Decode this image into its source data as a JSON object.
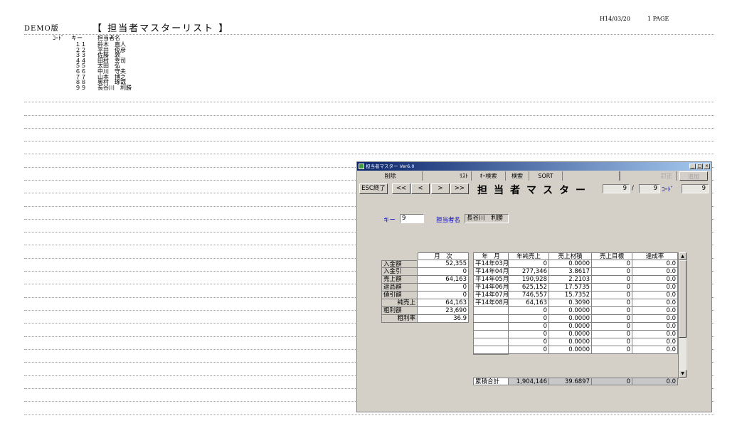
{
  "report": {
    "demo_label": "DEMO版",
    "title": "【 担当者マスターリスト 】",
    "date": "H14/03/20",
    "page": "1 PAGE",
    "col_code": "ｺｰﾄﾞ",
    "col_key": "キー",
    "col_name": "担当者名",
    "rows": [
      {
        "key": "１１",
        "name": "鈴木　直人"
      },
      {
        "key": "２２",
        "name": "平井　俊彦"
      },
      {
        "key": "３３",
        "name": "佐藤　敦"
      },
      {
        "key": "４４",
        "name": "田村　幸司"
      },
      {
        "key": "５５",
        "name": "太田　弘"
      },
      {
        "key": "６６",
        "name": "中川　守夫"
      },
      {
        "key": "７７",
        "name": "山本　博之"
      },
      {
        "key": "８８",
        "name": "奥村　琢哉"
      },
      {
        "key": "９９",
        "name": "長谷川　利勝"
      }
    ]
  },
  "window": {
    "title": "担当者マスター Ver6.0",
    "min_glyph": "_",
    "max_glyph": "□",
    "close_glyph": "×",
    "toolbar": {
      "delete": "削除",
      "list": "ﾘｽﾄ",
      "key_search": "ｷｰ検索",
      "search": "検索",
      "sort": "SORT",
      "correct": "訂正",
      "add": "追加"
    },
    "esc_button": "ESC終了",
    "nav": {
      "first": "<<",
      "prev": "<",
      "next": ">",
      "last": ">>"
    },
    "screen_title": "担当者マスター",
    "record_current": "9",
    "record_sep": "/",
    "record_total": "9",
    "code_label": "ｺｰﾄﾞ",
    "code_value": "9",
    "key_label": "キー",
    "key_value": "9",
    "name_label": "担当者名",
    "name_value": "長谷川　利勝",
    "monthly": {
      "header": "月　次",
      "rows": [
        {
          "label": "入金額",
          "value": "52,355"
        },
        {
          "label": "入金引",
          "value": "0"
        },
        {
          "label": "売上額",
          "value": "64,163"
        },
        {
          "label": "返品額",
          "value": "0"
        },
        {
          "label": "値引額",
          "value": "0"
        },
        {
          "label": "純売上",
          "value": "64,163"
        },
        {
          "label": "粗利額",
          "value": "23,690"
        },
        {
          "label": "粗利率",
          "value": "36.9"
        }
      ]
    },
    "yearly": {
      "headers": [
        "年　月",
        "年純売上",
        "売上材積",
        "売上目標",
        "達成率"
      ],
      "rows": [
        {
          "ym": "平14年03月",
          "sales": "0",
          "vol": "0.0000",
          "target": "0",
          "rate": "0.0"
        },
        {
          "ym": "平14年04月",
          "sales": "277,346",
          "vol": "3.8617",
          "target": "0",
          "rate": "0.0"
        },
        {
          "ym": "平14年05月",
          "sales": "190,928",
          "vol": "2.2103",
          "target": "0",
          "rate": "0.0"
        },
        {
          "ym": "平14年06月",
          "sales": "625,152",
          "vol": "17.5735",
          "target": "0",
          "rate": "0.0"
        },
        {
          "ym": "平14年07月",
          "sales": "746,557",
          "vol": "15.7352",
          "target": "0",
          "rate": "0.0"
        },
        {
          "ym": "平14年08月",
          "sales": "64,163",
          "vol": "0.3090",
          "target": "0",
          "rate": "0.0"
        },
        {
          "ym": "",
          "sales": "0",
          "vol": "0.0000",
          "target": "0",
          "rate": "0.0"
        },
        {
          "ym": "",
          "sales": "0",
          "vol": "0.0000",
          "target": "0",
          "rate": "0.0"
        },
        {
          "ym": "",
          "sales": "0",
          "vol": "0.0000",
          "target": "0",
          "rate": "0.0"
        },
        {
          "ym": "",
          "sales": "0",
          "vol": "0.0000",
          "target": "0",
          "rate": "0.0"
        },
        {
          "ym": "",
          "sales": "0",
          "vol": "0.0000",
          "target": "0",
          "rate": "0.0"
        },
        {
          "ym": "",
          "sales": "0",
          "vol": "0.0000",
          "target": "0",
          "rate": "0.0"
        }
      ],
      "total": {
        "label": "累積合計",
        "sales": "1,904,146",
        "vol": "39.6897",
        "target": "0",
        "rate": "0.0"
      }
    },
    "scroll_up": "▲",
    "scroll_down": "▼"
  }
}
